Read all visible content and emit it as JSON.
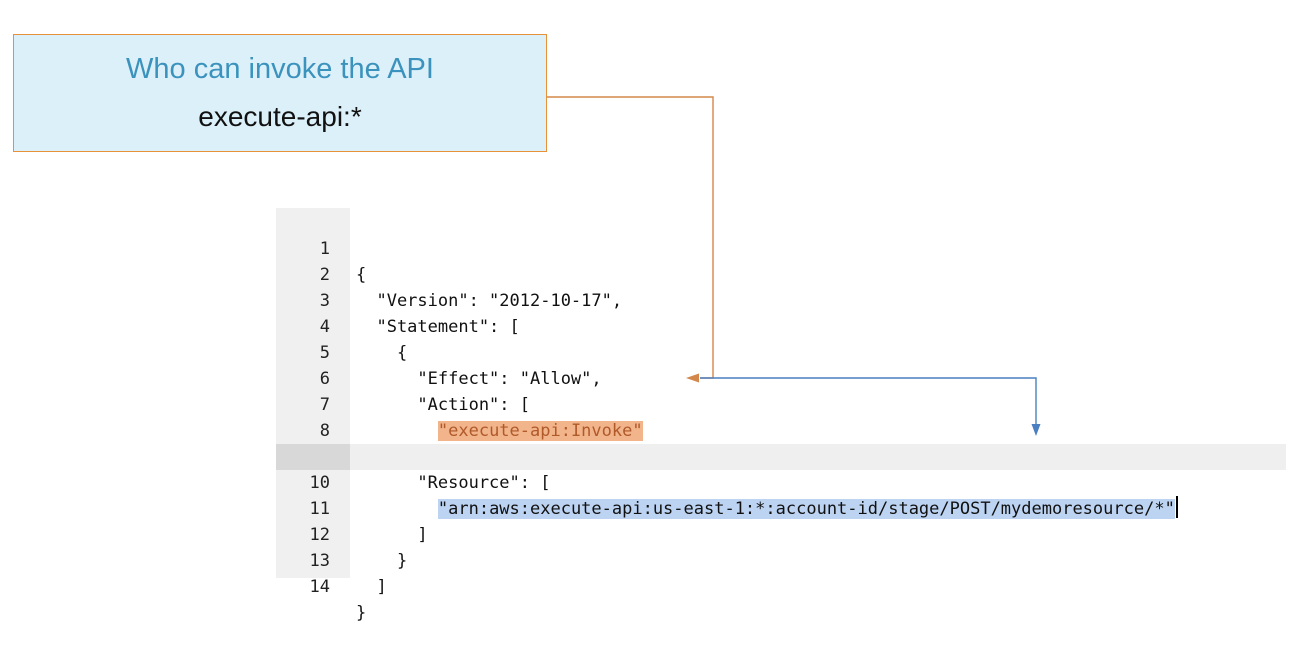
{
  "callout": {
    "title": "Who can invoke the API",
    "subtitle": "execute-api:*"
  },
  "editor": {
    "active_line": 10,
    "lines": [
      {
        "n": "1",
        "text": "{"
      },
      {
        "n": "2",
        "text": "  \"Version\": \"2012-10-17\","
      },
      {
        "n": "3",
        "text": "  \"Statement\": ["
      },
      {
        "n": "4",
        "text": "    {"
      },
      {
        "n": "5",
        "text": "      \"Effect\": \"Allow\","
      },
      {
        "n": "6",
        "text": "      \"Action\": ["
      },
      {
        "n": "7",
        "text": "        \"execute-api:Invoke\""
      },
      {
        "n": "8",
        "text": "      ],"
      },
      {
        "n": "9",
        "text": "      \"Resource\": ["
      },
      {
        "n": "10",
        "text": "        \"arn:aws:execute-api:us-east-1:*:account-id/stage/POST/mydemoresource/*\""
      },
      {
        "n": "11",
        "text": "      ]"
      },
      {
        "n": "12",
        "text": "    }"
      },
      {
        "n": "13",
        "text": "  ]"
      },
      {
        "n": "14",
        "text": "}"
      }
    ]
  },
  "colors": {
    "callout_bg": "#dcf0fa",
    "callout_border": "#e8913b",
    "callout_title": "#3b93bd",
    "action_highlight": "#f2b48b",
    "resource_highlight": "#bcd3f2",
    "orange_connector": "#d4874a",
    "blue_connector": "#4a7fc1"
  }
}
